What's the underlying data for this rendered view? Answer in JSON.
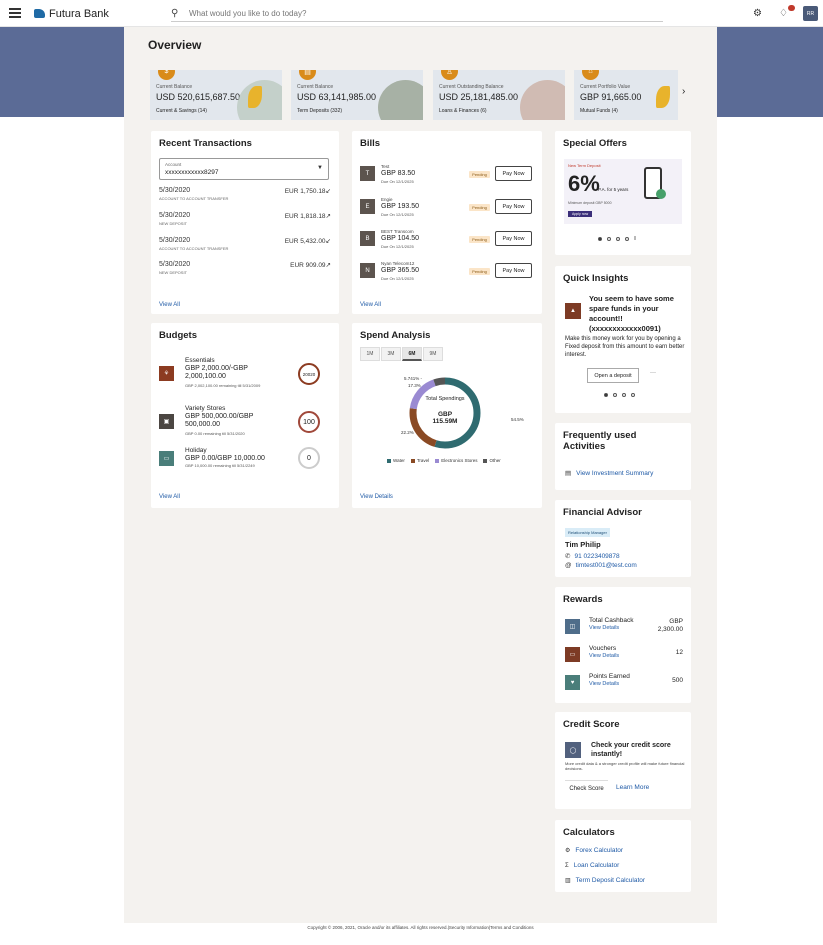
{
  "topbar": {
    "brand": "Futura Bank",
    "search_placeholder": "What would you like to do today?",
    "avatar": "RR",
    "icons": [
      "menu-icon",
      "logo-icon",
      "search-icon",
      "settings-icon",
      "bell-icon"
    ]
  },
  "overview": {
    "title": "Overview",
    "balances": [
      {
        "label": "Current Balance",
        "amount": "USD 520,615,687.50",
        "sub": "Current & Savings (14)",
        "icon": "$"
      },
      {
        "label": "Current Balance",
        "amount": "USD 63,141,985.00",
        "sub": "Term Deposits (332)",
        "icon": "▤"
      },
      {
        "label": "Current Outstanding Balance",
        "amount": "USD 25,181,485.00",
        "sub": "Loans & Finances (6)",
        "icon": "♙"
      },
      {
        "label": "Current Portfolio Value",
        "amount": "GBP 91,665.00",
        "sub": "Mutual Funds (4)",
        "icon": "⌂"
      }
    ],
    "next_icon": "›"
  },
  "transactions": {
    "title": "Recent Transactions",
    "account_label": "Account",
    "account_value": "xxxxxxxxxxxx8297",
    "rows": [
      {
        "date": "5/30/2020",
        "desc": "ACCOUNT TO ACCOUNT TRANSFER",
        "amount": "EUR 1,750.18↙"
      },
      {
        "date": "5/30/2020",
        "desc": "NEW DEPOSIT",
        "amount": "EUR 1,818.18↗"
      },
      {
        "date": "5/30/2020",
        "desc": "ACCOUNT TO ACCOUNT TRANSFER",
        "amount": "EUR 5,432.00↙"
      },
      {
        "date": "5/30/2020",
        "desc": "NEW DEPOSIT",
        "amount": "EUR 909.09↗"
      }
    ],
    "view_all": "View All"
  },
  "bills": {
    "title": "Bills",
    "rows": [
      {
        "initial": "T",
        "name": "Test",
        "amount": "GBP 83.50",
        "due": "Due On 12/1/2025",
        "status": "Pending",
        "action": "Pay Now"
      },
      {
        "initial": "E",
        "name": "Engie",
        "amount": "GBP 193.50",
        "due": "Due On 12/1/2025",
        "status": "Pending",
        "action": "Pay Now"
      },
      {
        "initial": "B",
        "name": "BEST Transcom",
        "amount": "GBP 104.50",
        "due": "Due On 12/1/2025",
        "status": "Pending",
        "action": "Pay Now"
      },
      {
        "initial": "N",
        "name": "Nyan Telecom12",
        "amount": "GBP 365.50",
        "due": "Due On 12/1/2025",
        "status": "Pending",
        "action": "Pay Now"
      }
    ],
    "view_all": "View All"
  },
  "offers": {
    "title": "Special Offers",
    "banner_small": "New Term Deposit",
    "banner_big": "6%",
    "banner_rest": "P.A. for 5 years",
    "banner_note": "Minimum deposit GBP 5000",
    "banner_btn": "Apply now"
  },
  "budgets": {
    "title": "Budgets",
    "rows": [
      {
        "name": "Essentials",
        "value": "GBP 2,000.00/-GBP 2,000,100.00",
        "remain": "GBP 2,002,100.00 remaining till 5/31/2009",
        "ring": "20020",
        "icon": "⚘",
        "color": "#8c3b21"
      },
      {
        "name": "Variety Stores",
        "value": "GBP 500,000.00/GBP 500,000.00",
        "remain": "GBP 0.00 remaining till 5/31/2020",
        "ring": "100",
        "icon": "▣",
        "color": "#4b4642"
      },
      {
        "name": "Holiday",
        "value": "GBP 0.00/GBP 10,000.00",
        "remain": "GBP 10,000.00 remaining till 5/31/2249",
        "ring": "0",
        "icon": "▭",
        "color": "#4a7e7a"
      }
    ],
    "view_all": "View All"
  },
  "spend": {
    "title": "Spend Analysis",
    "tabs": [
      "1M",
      "3M",
      "6M",
      "9M"
    ],
    "active_tab": "6M",
    "center_label": "Total Spendings",
    "center_value": "GBP 115.59M",
    "labels": {
      "a": "5.741% -",
      "b": "17.3%",
      "c": "54.5%",
      "d": "22.2%"
    },
    "legend": [
      {
        "name": "Water",
        "color": "#2f6b70"
      },
      {
        "name": "Travel",
        "color": "#8a4a24"
      },
      {
        "name": "Electronics Stores",
        "color": "#9a8ad2"
      },
      {
        "name": "Other",
        "color": "#555555"
      }
    ],
    "view_details": "View Details"
  },
  "insights": {
    "title": "Quick Insights",
    "head": "You seem to have some spare funds in your account!! (xxxxxxxxxxxx0091)",
    "body": "Make this money work for you by opening a Fixed deposit from this amount to earn better interest.",
    "button": "Open a deposit",
    "more": "···"
  },
  "frequent": {
    "title": "Frequently used Activities",
    "item": "View Investment Summary"
  },
  "advisor": {
    "title": "Financial Advisor",
    "tag": "Relationship Manager",
    "name": "Tim Philip",
    "phone": "91 0223409878",
    "email": "timtest001@test.com"
  },
  "rewards": {
    "title": "Rewards",
    "rows": [
      {
        "name": "Total Cashback",
        "link": "View Details",
        "value": "GBP 2,300.00",
        "icon": "◫",
        "color": "#4f6d8a"
      },
      {
        "name": "Vouchers",
        "link": "View Details",
        "value": "12",
        "icon": "▭",
        "color": "#7d3b25"
      },
      {
        "name": "Points Earned",
        "link": "View Details",
        "value": "500",
        "icon": "♥",
        "color": "#4a7e7a"
      }
    ]
  },
  "credit": {
    "title": "Credit Score",
    "head": "Check your credit score instantly!",
    "sub": "More credit data & a stronger credit profile will make future financial decisions.",
    "button": "Check Score",
    "link": "Learn More"
  },
  "calculators": {
    "title": "Calculators",
    "items": [
      {
        "icon": "⚙",
        "label": "Forex Calculator"
      },
      {
        "icon": "Σ",
        "label": "Loan Calculator"
      },
      {
        "icon": "▥",
        "label": "Term Deposit Calculator"
      }
    ]
  },
  "footer": "Copyright © 2006, 2021, Oracle and/or its affiliates. All rights reserved.|Security Information|Terms and Conditions"
}
